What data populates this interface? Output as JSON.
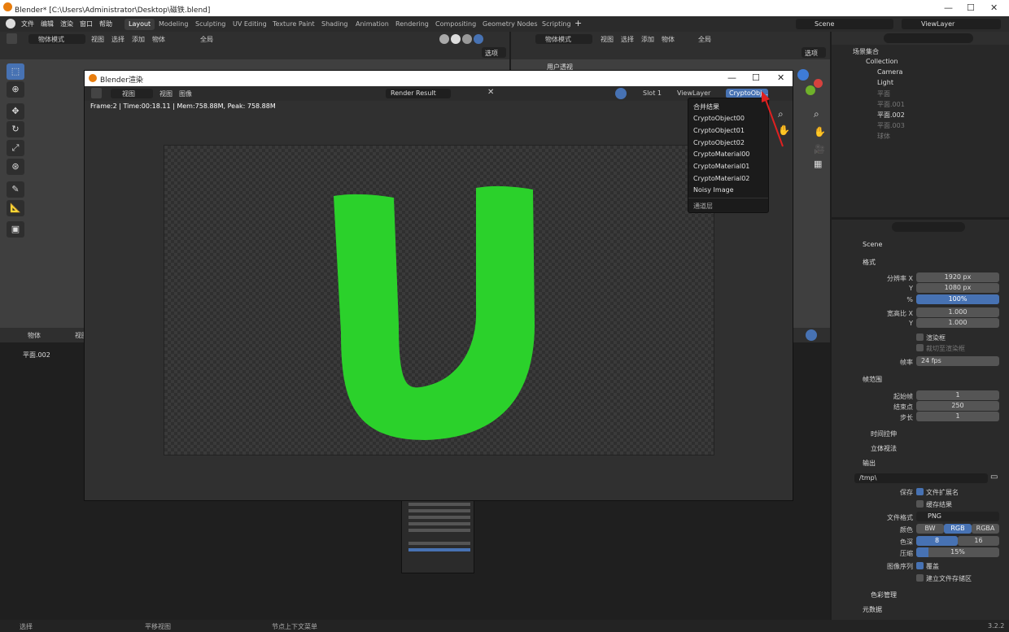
{
  "window": {
    "title": "Blender* [C:\\Users\\Administrator\\Desktop\\磁铁.blend]"
  },
  "menu": [
    "文件",
    "编辑",
    "渲染",
    "窗口",
    "帮助"
  ],
  "workspaces": [
    "Layout",
    "Modeling",
    "Sculpting",
    "UV Editing",
    "Texture Paint",
    "Shading",
    "Animation",
    "Rendering",
    "Compositing",
    "Geometry Nodes",
    "Scripting"
  ],
  "topright": {
    "scene": "Scene",
    "viewlayer": "ViewLayer"
  },
  "viewport_header": {
    "mode": "物体模式",
    "menus": [
      "视图",
      "选择",
      "添加",
      "物体"
    ],
    "transform": "全局",
    "options": "选项"
  },
  "right_viewport_header": {
    "mode": "物体模式",
    "menus": [
      "视图",
      "选择",
      "添加",
      "物体"
    ],
    "transform": "全局",
    "options": "选项",
    "label": "用户透视"
  },
  "lower_header": {
    "mode": "物体",
    "menu": "视图",
    "breadcrumb": "平面.002"
  },
  "outliner": {
    "root": "场景集合",
    "collection": "Collection",
    "items": [
      "Camera",
      "Light",
      "平面",
      "平面.001",
      "平面.002",
      "平面.003",
      "球体"
    ]
  },
  "render_window": {
    "title": "Blender渲染",
    "menus": [
      "视图",
      "视图",
      "图像"
    ],
    "image_name": "Render Result",
    "slot": "Slot 1",
    "viewlayer": "ViewLayer",
    "pass": "CryptoObj...",
    "info": "Frame:2 | Time:00:18.11 | Mem:758.88M, Peak: 758.88M"
  },
  "pass_dropdown": [
    "合并结果",
    "CryptoObject00",
    "CryptoObject01",
    "CryptoObject02",
    "CryptoMaterial00",
    "CryptoMaterial01",
    "CryptoMaterial02",
    "Noisy Image",
    "通道层"
  ],
  "properties": {
    "scene": "Scene",
    "format_section": "格式",
    "res_x_label": "分辨率 X",
    "res_x": "1920 px",
    "res_y_label": "Y",
    "res_y": "1080 px",
    "pct_label": "%",
    "pct": "100%",
    "aspect_x_label": "宽高比 X",
    "aspect_x": "1.000",
    "aspect_y_label": "Y",
    "aspect_y": "1.000",
    "border": "渲染框",
    "crop": "裁切至渲染框",
    "fps_label": "帧率",
    "fps": "24 fps",
    "frame_range_section": "帧范围",
    "start_label": "起始帧",
    "start": "1",
    "end_label": "结束点",
    "end": "250",
    "step_label": "步长",
    "step": "1",
    "time_stretch": "时间拉伸",
    "stereo": "立体视法",
    "output_section": "输出",
    "path": "/tmp\\",
    "save_label": "保存",
    "file_ext": "文件扩展名",
    "cache": "缓存结果",
    "format_label": "文件格式",
    "format": "PNG",
    "color_label": "颜色",
    "color_bw": "BW",
    "color_rgb": "RGB",
    "color_rgba": "RGBA",
    "depth_label": "色深",
    "depth_8": "8",
    "depth_16": "16",
    "compress_label": "压缩",
    "compress": "15%",
    "seq_label": "图像序列",
    "overwrite": "覆盖",
    "placeholders": "建立文件存储区",
    "color_mgmt": "色彩管理",
    "metadata": "元数据"
  },
  "status": {
    "select": "选择",
    "pan": "平移视图",
    "menu": "节点上下文菜单",
    "version": "3.2.2"
  },
  "colors": {
    "accent": "#4772b3",
    "u_shape": "#2bd12b",
    "arrow": "#e02020"
  }
}
